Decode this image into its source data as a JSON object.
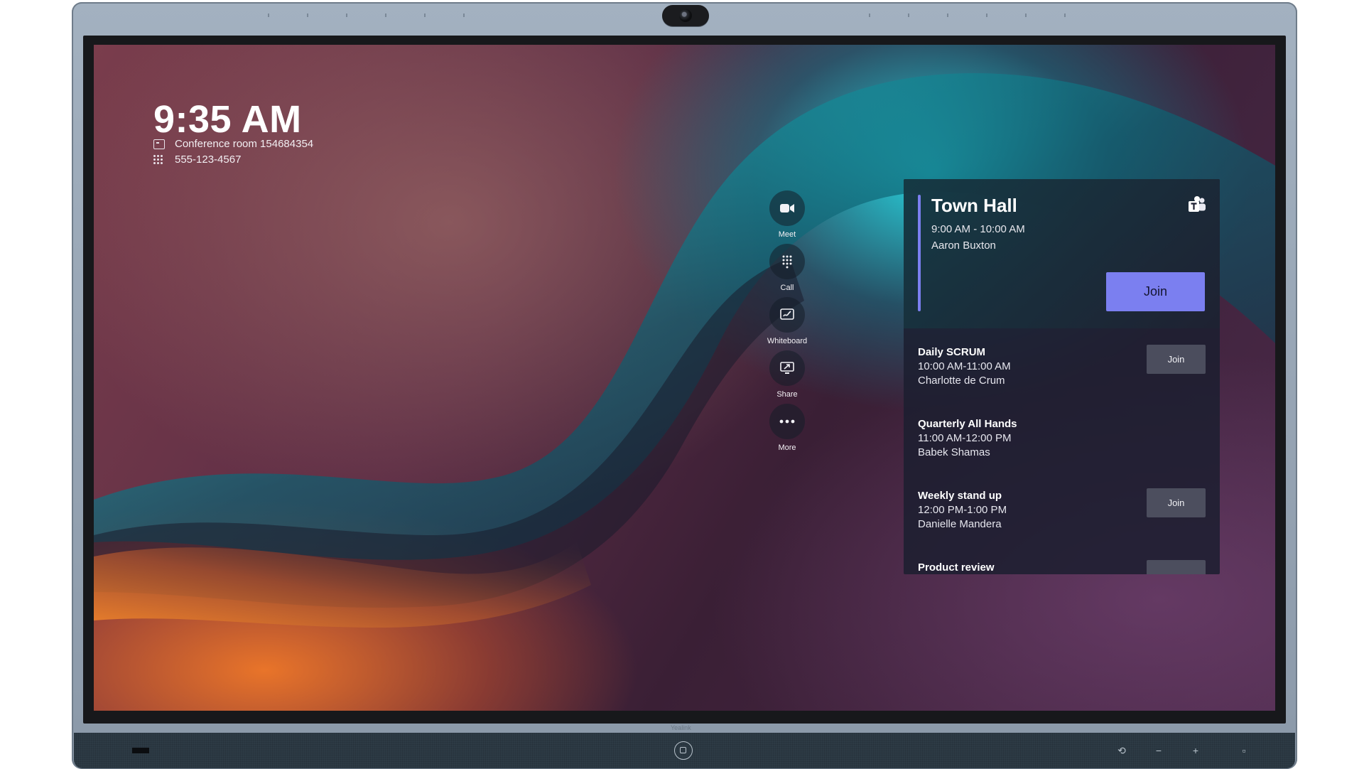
{
  "status": {
    "time": "9:35 AM",
    "room": "Conference room 154684354",
    "phone": "555-123-4567",
    "icons": {
      "room": "room-display-icon",
      "phone": "dialpad-icon"
    }
  },
  "actions": [
    {
      "label": "Meet",
      "icon": "video-camera-icon"
    },
    {
      "label": "Call",
      "icon": "dialpad-icon"
    },
    {
      "label": "Whiteboard",
      "icon": "whiteboard-icon"
    },
    {
      "label": "Share",
      "icon": "share-screen-icon"
    },
    {
      "label": "More",
      "icon": "more-dots-icon"
    }
  ],
  "featured_meeting": {
    "title": "Town Hall",
    "time": "9:00 AM - 10:00 AM",
    "organizer": "Aaron Buxton",
    "join_label": "Join",
    "app_icon": "teams-icon"
  },
  "meetings": [
    {
      "title": "Daily SCRUM",
      "time": "10:00 AM-11:00 AM",
      "organizer": "Charlotte de Crum",
      "join_label": "Join"
    },
    {
      "title": "Quarterly All Hands",
      "time": "11:00 AM-12:00 PM",
      "organizer": "Babek Shamas",
      "join_label": ""
    },
    {
      "title": "Weekly stand up",
      "time": "12:00 PM-1:00 PM",
      "organizer": "Danielle Mandera",
      "join_label": "Join"
    },
    {
      "title": "Product review",
      "time": "",
      "organizer": "",
      "join_label": ""
    }
  ],
  "device": {
    "brand": "Yealink",
    "controls": [
      "home-icon",
      "back-icon",
      "volume-down-icon",
      "volume-up-icon",
      "input-source-icon"
    ]
  },
  "colors": {
    "accent": "#7b7ff0",
    "panel": "#1c1e30",
    "text": "#ffffff"
  }
}
